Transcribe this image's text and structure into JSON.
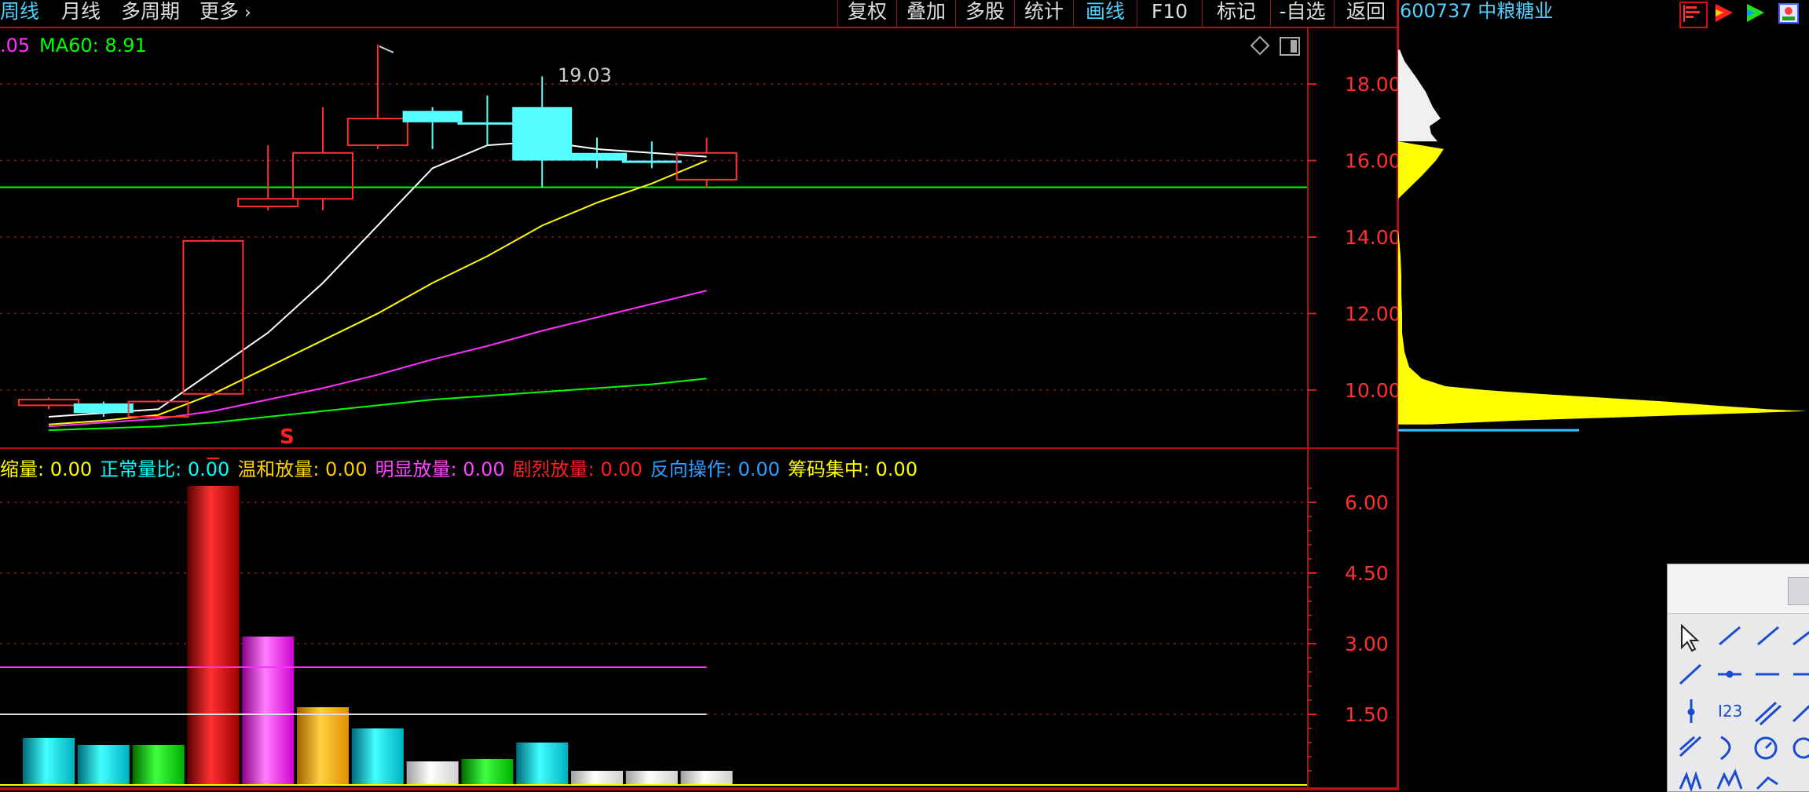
{
  "topbar": {
    "tabs": [
      "周线",
      "月线",
      "多周期",
      "更多"
    ],
    "tools": [
      "复权",
      "叠加",
      "多股",
      "统计",
      "画线",
      "F10",
      "标记",
      "-自选",
      "返回"
    ],
    "active_tool": "画线",
    "stock": "600737 中粮糖业"
  },
  "main": {
    "ma_label_partial": ".05",
    "ma60_label": "MA60: 8.91",
    "high_marker": "19.03",
    "y_ticks": [
      "18.00",
      "16.00",
      "14.00",
      "12.00",
      "10.00"
    ]
  },
  "volume": {
    "s_marker": "S",
    "indicators": [
      {
        "label": "缩量",
        "value": "0.00",
        "color": "#ffff00"
      },
      {
        "label": "正常量比",
        "value": "0.00",
        "color": "#00ffff"
      },
      {
        "label": "温和放量",
        "value": "0.00",
        "color": "#ffd000"
      },
      {
        "label": "明显放量",
        "value": "0.00",
        "color": "#ff44ff"
      },
      {
        "label": "剧烈放量",
        "value": "0.00",
        "color": "#ff2020"
      },
      {
        "label": "反向操作",
        "value": "0.00",
        "color": "#2e9bff"
      },
      {
        "label": "筹码集中",
        "value": "0.00",
        "color": "#ffff00"
      }
    ],
    "y_ticks": [
      "6.00",
      "4.50",
      "3.00",
      "1.50"
    ]
  },
  "chart_data": {
    "type": "candlestick",
    "price_ylim": [
      8.5,
      19.5
    ],
    "candles": [
      {
        "open": 9.6,
        "close": 9.75,
        "high": 9.8,
        "low": 9.5
      },
      {
        "open": 9.4,
        "close": 9.65,
        "high": 9.7,
        "low": 9.3
      },
      {
        "open": 9.3,
        "close": 9.7,
        "high": 9.75,
        "low": 9.25
      },
      {
        "open": 9.9,
        "close": 13.9,
        "high": 13.95,
        "low": 9.85
      },
      {
        "open": 14.8,
        "close": 15.0,
        "high": 16.4,
        "low": 14.7
      },
      {
        "open": 15.0,
        "close": 16.2,
        "high": 17.4,
        "low": 14.7
      },
      {
        "open": 16.4,
        "close": 17.1,
        "high": 19.03,
        "low": 16.3
      },
      {
        "open": 17.3,
        "close": 17.0,
        "high": 17.4,
        "low": 16.3
      },
      {
        "open": 17.0,
        "close": 17.0,
        "high": 17.7,
        "low": 16.4
      },
      {
        "open": 17.4,
        "close": 16.0,
        "high": 18.2,
        "low": 15.3
      },
      {
        "open": 16.2,
        "close": 16.0,
        "high": 16.6,
        "low": 15.8
      },
      {
        "open": 16.0,
        "close": 16.0,
        "high": 16.5,
        "low": 15.8
      },
      {
        "open": 15.5,
        "close": 16.2,
        "high": 16.6,
        "low": 15.3
      }
    ],
    "candle_colors": [
      "#ff3030",
      "#55ffff",
      "#ff3030",
      "#ff3030",
      "#ff3030",
      "#ff3030",
      "#ff3030",
      "#55ffff",
      "#55ffff",
      "#55ffff",
      "#55ffff",
      "#55ffff",
      "#ff3030"
    ],
    "horizontal_line": 15.3,
    "series": [
      {
        "color": "#ffffff",
        "values": [
          9.3,
          9.4,
          9.5,
          10.5,
          11.5,
          12.8,
          14.3,
          15.8,
          16.4,
          16.5,
          16.3,
          16.2,
          16.1
        ]
      },
      {
        "color": "#ffff00",
        "values": [
          9.1,
          9.2,
          9.35,
          9.9,
          10.6,
          11.3,
          12.0,
          12.8,
          13.5,
          14.3,
          14.9,
          15.4,
          16.0
        ]
      },
      {
        "color": "#ff30ff",
        "values": [
          9.05,
          9.15,
          9.25,
          9.45,
          9.75,
          10.05,
          10.4,
          10.8,
          11.15,
          11.55,
          11.9,
          12.25,
          12.6
        ]
      },
      {
        "color": "#00ff00",
        "values": [
          8.95,
          9.0,
          9.05,
          9.15,
          9.3,
          9.45,
          9.6,
          9.75,
          9.85,
          9.95,
          10.05,
          10.15,
          10.3
        ]
      }
    ],
    "volume_ylim": [
      0,
      6.5
    ],
    "volume": [
      {
        "value": 1.0,
        "color": "cyan"
      },
      {
        "value": 0.85,
        "color": "cyan"
      },
      {
        "value": 0.85,
        "color": "green"
      },
      {
        "value": 6.35,
        "color": "red"
      },
      {
        "value": 3.15,
        "color": "magenta"
      },
      {
        "value": 1.65,
        "color": "orange"
      },
      {
        "value": 1.2,
        "color": "cyan"
      },
      {
        "value": 0.5,
        "color": "white"
      },
      {
        "value": 0.55,
        "color": "green"
      },
      {
        "value": 0.9,
        "color": "cyan"
      },
      {
        "value": 0.3,
        "color": "white"
      },
      {
        "value": 0.3,
        "color": "white"
      },
      {
        "value": 0.3,
        "color": "white"
      }
    ],
    "volume_ref_lines": [
      {
        "value": 2.5,
        "color": "#ff30ff"
      },
      {
        "value": 1.5,
        "color": "#dddddd"
      }
    ]
  }
}
